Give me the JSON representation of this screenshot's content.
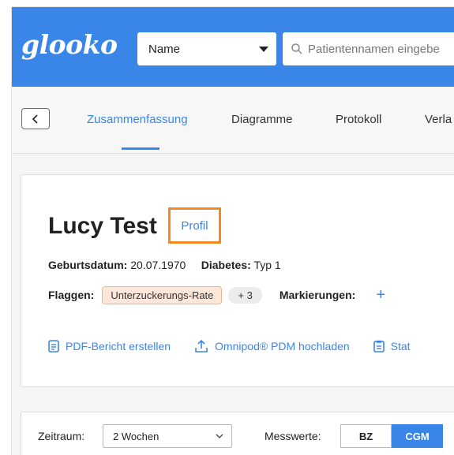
{
  "header": {
    "logo": "glooko",
    "search_type": "Name",
    "search_placeholder": "Patientennamen eingebe"
  },
  "tabs": [
    {
      "label": "Zusammenfassung",
      "active": true
    },
    {
      "label": "Diagramme",
      "active": false
    },
    {
      "label": "Protokoll",
      "active": false
    },
    {
      "label": "Verla",
      "active": false
    }
  ],
  "patient": {
    "name": "Lucy Test",
    "profile_link": "Profil",
    "dob_label": "Geburtsdatum:",
    "dob": "20.07.1970",
    "diabetes_label": "Diabetes:",
    "diabetes": "Typ 1",
    "flags_label": "Flaggen:",
    "flag": "Unterzuckerungs-Rate",
    "more_flags": "+ 3",
    "markers_label": "Markierungen:",
    "markers_add": "+"
  },
  "actions": [
    {
      "label": "PDF-Bericht erstellen",
      "icon": "document-icon"
    },
    {
      "label": "Omnipod® PDM hochladen",
      "icon": "upload-icon"
    },
    {
      "label": "Stat",
      "icon": "clipboard-icon"
    }
  ],
  "filters": {
    "period_label": "Zeitraum:",
    "period_value": "2 Wochen",
    "values_label": "Messwerte:",
    "option_bz": "BZ",
    "option_cgm": "CGM",
    "selected": "CGM"
  },
  "colors": {
    "brand_blue": "#3a86e8",
    "highlight_orange": "#f08a24",
    "flag_bg": "#fde7d9"
  }
}
